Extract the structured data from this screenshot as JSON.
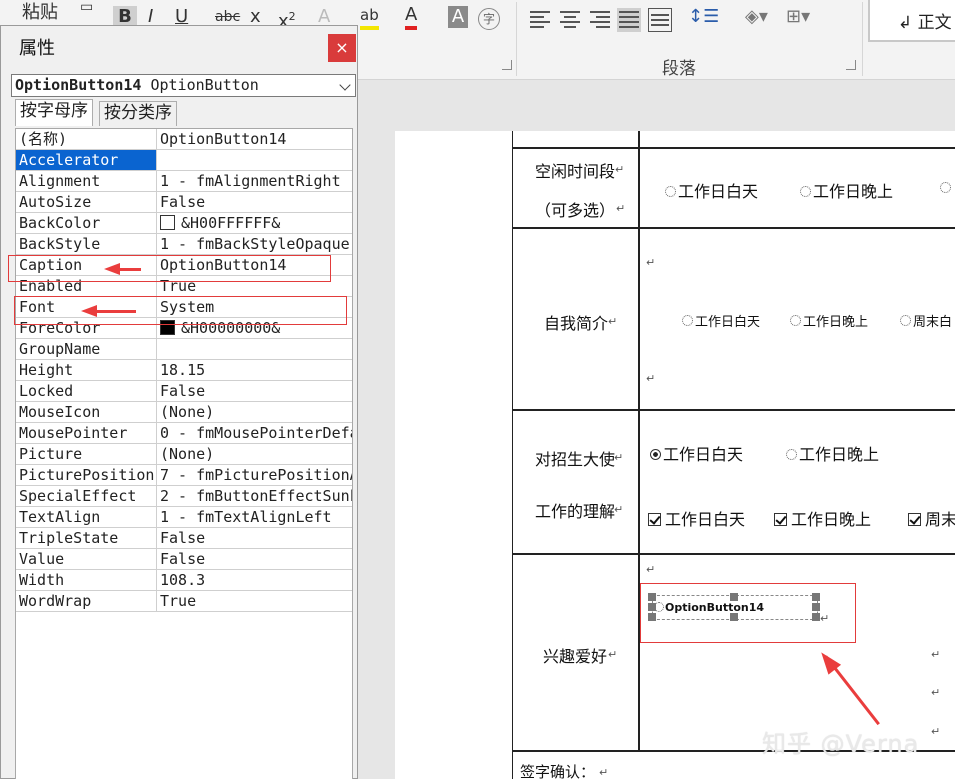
{
  "ribbon": {
    "paste_label": "粘贴",
    "bold": "B",
    "italic": "I",
    "underline": "U",
    "strikethrough": "abc",
    "subscript": "x",
    "superscript": "x",
    "superscript_mark": "2",
    "highlight": "ab",
    "font_color": "A",
    "char_shading": "A",
    "enclose": "字",
    "paragraph_group": "段落",
    "style_normal": "↲ 正文"
  },
  "properties": {
    "title": "属性",
    "close": "×",
    "object_name": "OptionButton14",
    "object_type": "OptionButton",
    "tabs": [
      "按字母序",
      "按分类序"
    ],
    "rows": [
      {
        "name": "(名称)",
        "value": "OptionButton14"
      },
      {
        "name": "Accelerator",
        "value": ""
      },
      {
        "name": "Alignment",
        "value": "1 - fmAlignmentRight"
      },
      {
        "name": "AutoSize",
        "value": "False"
      },
      {
        "name": "BackColor",
        "value": "&H00FFFFFF&"
      },
      {
        "name": "BackStyle",
        "value": "1 - fmBackStyleOpaque"
      },
      {
        "name": "Caption",
        "value": "OptionButton14"
      },
      {
        "name": "Enabled",
        "value": "True"
      },
      {
        "name": "Font",
        "value": "System"
      },
      {
        "name": "ForeColor",
        "value": "&H00000000&"
      },
      {
        "name": "GroupName",
        "value": ""
      },
      {
        "name": "Height",
        "value": "18.15"
      },
      {
        "name": "Locked",
        "value": "False"
      },
      {
        "name": "MouseIcon",
        "value": "(None)"
      },
      {
        "name": "MousePointer",
        "value": "0 - fmMousePointerDefa"
      },
      {
        "name": "Picture",
        "value": "(None)"
      },
      {
        "name": "PicturePosition",
        "value": "7 - fmPicturePositionA"
      },
      {
        "name": "SpecialEffect",
        "value": "2 - fmButtonEffectSunk"
      },
      {
        "name": "TextAlign",
        "value": "1 - fmTextAlignLeft"
      },
      {
        "name": "TripleState",
        "value": "False"
      },
      {
        "name": "Value",
        "value": "False"
      },
      {
        "name": "Width",
        "value": "108.3"
      },
      {
        "name": "WordWrap",
        "value": "True"
      }
    ],
    "colors": {
      "backcolor": "#ffffff",
      "forecolor": "#000000",
      "selection": "#0a64d0"
    }
  },
  "document": {
    "row1_label_a": "空闲时间段",
    "row1_label_b": "（可多选）",
    "row1_opt1": "工作日白天",
    "row1_opt2": "工作日晚上",
    "row2_label": "自我简介",
    "row2_opt1": "工作日白天",
    "row2_opt2": "工作日晚上",
    "row2_opt3": "周末白",
    "row3_label_a": "对招生大使",
    "row3_label_b": "工作的理解",
    "row3_radio1": "工作日白天",
    "row3_radio2": "工作日晚上",
    "row3_check1": "工作日白天",
    "row3_check2": "工作日晚上",
    "row3_check3": "周末",
    "row4_label": "兴趣爱好",
    "control_caption": "OptionButton14",
    "signature": "签字确认：",
    "para_mark": "↵",
    "watermark": "知乎 @Verna"
  }
}
